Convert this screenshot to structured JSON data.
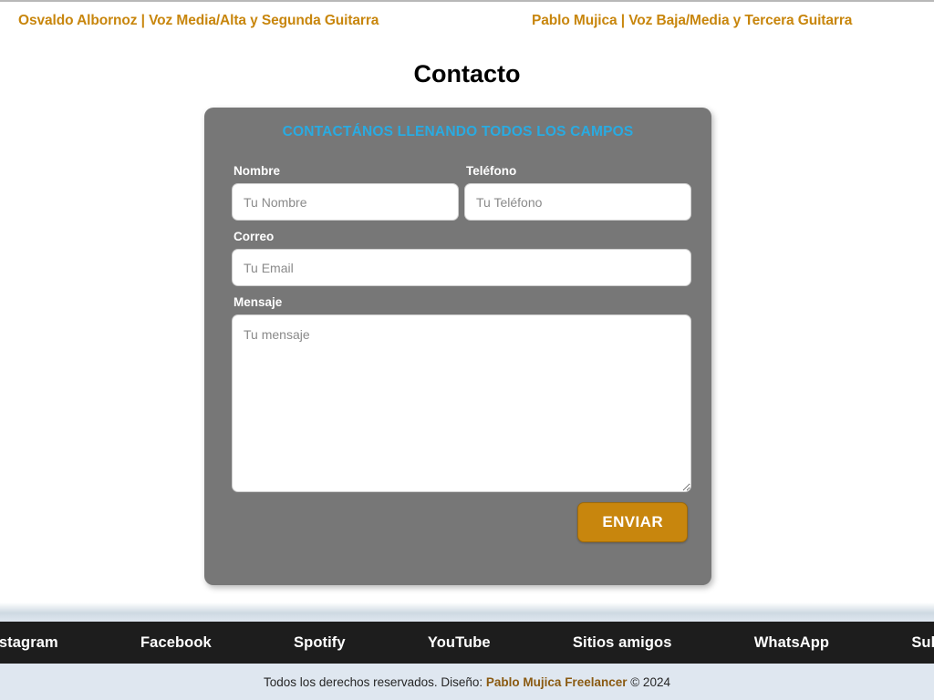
{
  "members": {
    "left": "Osvaldo Albornoz | Voz Media/Alta y Segunda Guitarra",
    "right": "Pablo Mujica | Voz Baja/Media y Tercera Guitarra"
  },
  "page": {
    "title": "Contacto"
  },
  "form": {
    "heading": "CONTACTÁNOS LLENANDO TODOS LOS CAMPOS",
    "fields": {
      "nombre": {
        "label": "Nombre",
        "placeholder": "Tu Nombre",
        "value": ""
      },
      "telefono": {
        "label": "Teléfono",
        "placeholder": "Tu Teléfono",
        "value": ""
      },
      "correo": {
        "label": "Correo",
        "placeholder": "Tu Email",
        "value": ""
      },
      "mensaje": {
        "label": "Mensaje",
        "placeholder": "Tu mensaje",
        "value": ""
      }
    },
    "submit_label": "ENVIAR"
  },
  "footer_nav": [
    {
      "label": "Instagram"
    },
    {
      "label": "Facebook"
    },
    {
      "label": "Spotify"
    },
    {
      "label": "YouTube"
    },
    {
      "label": "Sitios amigos"
    },
    {
      "label": "WhatsApp"
    },
    {
      "label": "Subir"
    }
  ],
  "copyright": {
    "prefix": "Todos los derechos reservados. Diseño: ",
    "brand": "Pablo Mujica Freelancer",
    "suffix": " © 2024"
  },
  "colors": {
    "member_gold": "#c8860d",
    "card_gray": "#777777",
    "heading_cyan": "#29abe2",
    "button_gold": "#c8860d",
    "footer_dark": "#1d1d1d",
    "copyright_bg": "#dfe7f0",
    "brand_brown": "#8a5a12"
  }
}
